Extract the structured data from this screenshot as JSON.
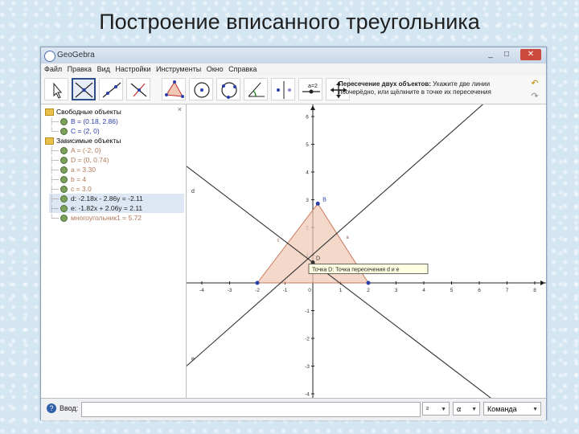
{
  "slide": {
    "title": "Построение вписанного треугольника"
  },
  "window": {
    "title": "GeoGebra",
    "buttons": {
      "minimize": "_",
      "maximize": "□",
      "close": "✕"
    }
  },
  "menu": [
    "Файл",
    "Правка",
    "Вид",
    "Настройки",
    "Инструменты",
    "Окно",
    "Справка"
  ],
  "toolbar": {
    "help_bold": "Пересечение двух объектов:",
    "help_text": " Укажите две линии поочерёдно, или щёлкните в точке их пересечения",
    "tools": [
      "move-tool",
      "intersect-tool",
      "line-tool",
      "perpendicular-tool",
      "polygon-tool",
      "circle-tool",
      "circle-three-points-tool",
      "angle-tool",
      "reflect-tool",
      "slider-tool",
      "move-view-tool"
    ]
  },
  "algebra": {
    "close": "×",
    "free_header": "Свободные объекты",
    "free": [
      {
        "text": "B = (0.18, 2.86)",
        "color": "#2a3fa8"
      },
      {
        "text": "C = (2, 0)",
        "color": "#2a3fa8"
      }
    ],
    "dependent_header": "Зависимые объекты",
    "dependent": [
      {
        "text": "A = (-2, 0)",
        "color": "#b07a5a"
      },
      {
        "text": "D = (0, 0.74)",
        "color": "#b07a5a"
      },
      {
        "text": "a = 3.30",
        "color": "#b07a5a"
      },
      {
        "text": "b = 4",
        "color": "#b07a5a"
      },
      {
        "text": "c = 3.0",
        "color": "#b07a5a"
      },
      {
        "text": "d: -2.18x - 2.86y = -2.11",
        "color": "#222222"
      },
      {
        "text": "e: -1.82x + 2.06y = 2.11",
        "color": "#222222"
      },
      {
        "text": "многоугольник1 = 5.72",
        "color": "#b07a5a"
      }
    ]
  },
  "graphics": {
    "x_ticks": [
      "-4",
      "-3",
      "-2",
      "-1",
      "0",
      "1",
      "2",
      "3",
      "4",
      "5",
      "6",
      "7",
      "8"
    ],
    "y_ticks": [
      "6",
      "5",
      "4",
      "3",
      "2",
      "1",
      "-1",
      "-2",
      "-3",
      "-4"
    ],
    "labels": {
      "B": "B",
      "D": "D",
      "d": "d",
      "e": "e",
      "c": "c",
      "a": "a"
    },
    "tooltip": "Точка D: Точка пересечения d и e",
    "colors": {
      "polygon_fill": "#f0c8b4",
      "polygon_stroke": "#c9785a",
      "line": "#333333",
      "point": "#2a3fa8"
    }
  },
  "inputbar": {
    "label": "Ввод:",
    "help": "?",
    "combo1": "²",
    "combo2": "α",
    "command": "Команда"
  }
}
